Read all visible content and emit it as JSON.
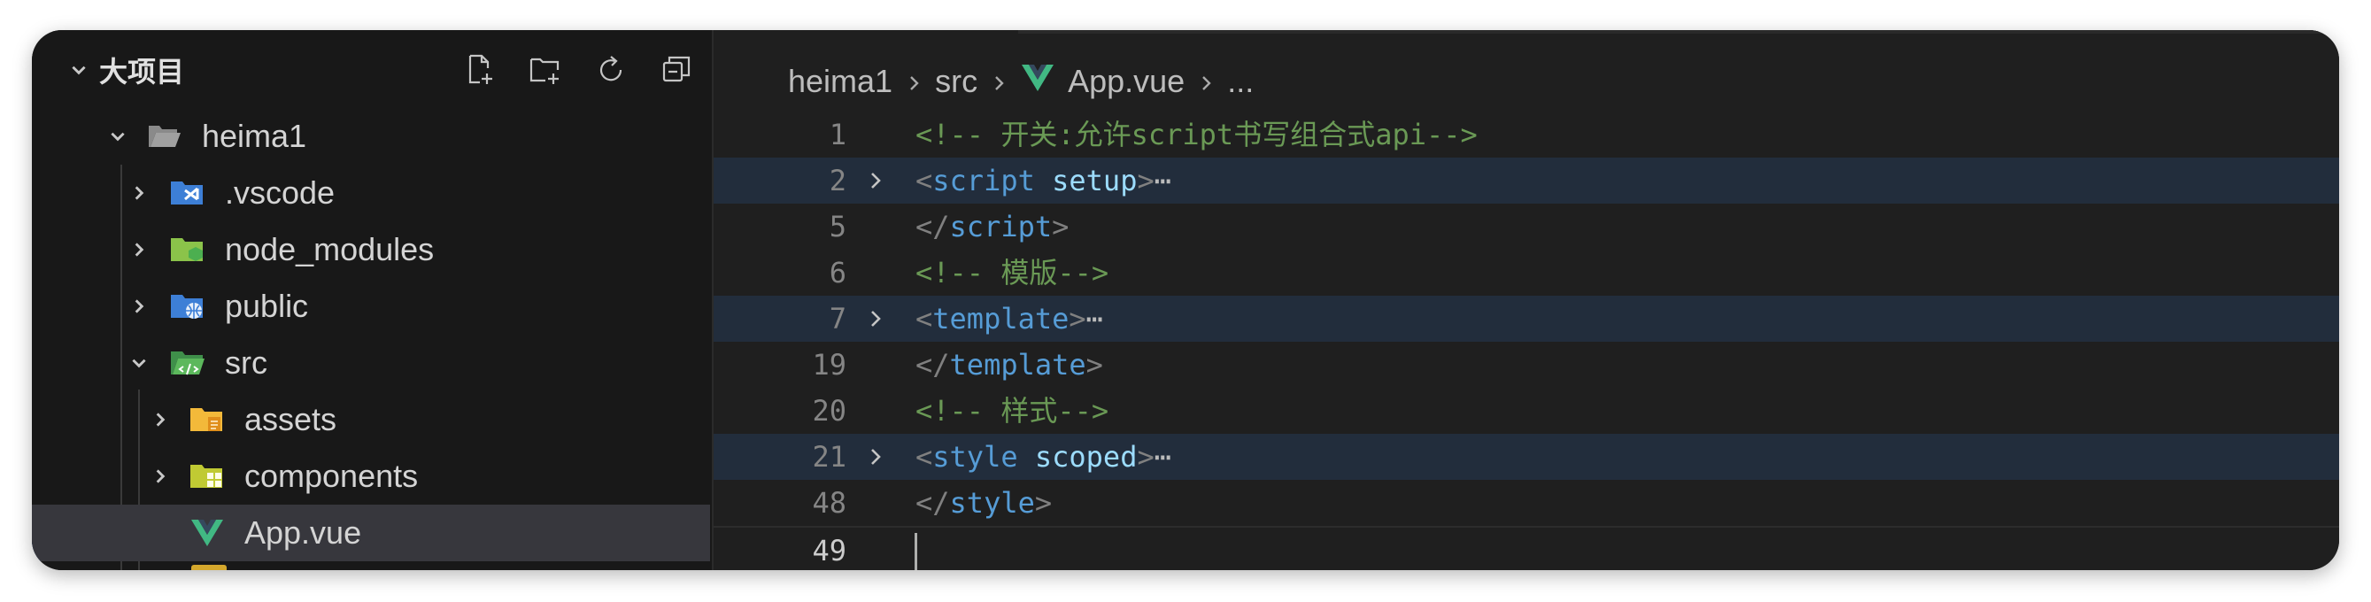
{
  "explorer": {
    "section_title": "大项目",
    "actions": [
      "new-file",
      "new-folder",
      "refresh",
      "collapse-all"
    ]
  },
  "tree": [
    {
      "label": "heima1",
      "icon": "folder-open-icon",
      "expanded": true
    },
    {
      "label": ".vscode",
      "icon": "vscode-folder-icon"
    },
    {
      "label": "node_modules",
      "icon": "node-folder-icon"
    },
    {
      "label": "public",
      "icon": "public-folder-icon"
    },
    {
      "label": "src",
      "icon": "src-folder-icon",
      "expanded": true
    },
    {
      "label": "assets",
      "icon": "assets-folder-icon"
    },
    {
      "label": "components",
      "icon": "components-folder-icon"
    },
    {
      "label": "App.vue",
      "icon": "vue-file-icon",
      "selected": true
    }
  ],
  "breadcrumb": {
    "items": [
      "heima1",
      "src",
      "App.vue",
      "..."
    ]
  },
  "code": {
    "lines": [
      {
        "n": "1",
        "comment": "<!-- 开关:允许script书写组合式api-->"
      },
      {
        "n": "2",
        "open": "<",
        "tag": "script",
        "attr": " setup",
        "close": ">",
        "ellipsis": "⋯"
      },
      {
        "n": "5",
        "open": "</",
        "tag": "script",
        "close": ">"
      },
      {
        "n": "6",
        "comment": "<!-- 模版-->"
      },
      {
        "n": "7",
        "open": "<",
        "tag": "template",
        "close": ">",
        "ellipsis": "⋯"
      },
      {
        "n": "19",
        "open": "</",
        "tag": "template",
        "close": ">"
      },
      {
        "n": "20",
        "comment": "<!-- 样式-->"
      },
      {
        "n": "21",
        "open": "<",
        "tag": "style",
        "attr": " scoped",
        "close": ">",
        "ellipsis": "⋯"
      },
      {
        "n": "48",
        "open": "</",
        "tag": "style",
        "close": ">"
      },
      {
        "n": "49"
      }
    ]
  },
  "colors": {
    "background": "#1f1f1f",
    "sidebar": "#181818",
    "selection": "#37373d",
    "comment": "#6a9955",
    "tag": "#569cd6",
    "attr": "#9cdcfe",
    "vue_green": "#41b883"
  }
}
